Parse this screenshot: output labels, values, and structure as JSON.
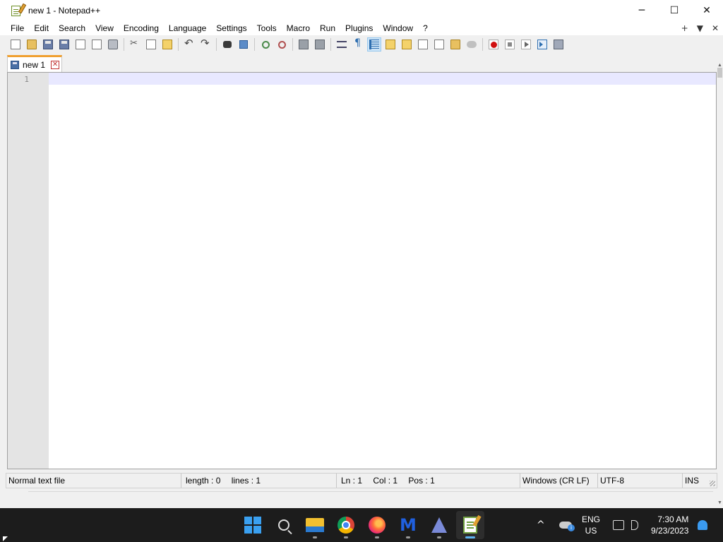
{
  "window": {
    "title": "new 1 - Notepad++",
    "controls": {
      "minimize": "─",
      "maximize": "☐",
      "close": "✕"
    }
  },
  "menu": {
    "items": [
      "File",
      "Edit",
      "Search",
      "View",
      "Encoding",
      "Language",
      "Settings",
      "Tools",
      "Macro",
      "Run",
      "Plugins",
      "Window",
      "?"
    ],
    "right": {
      "add": "+",
      "dropdown": "▼",
      "close": "✕"
    }
  },
  "toolbar": {
    "icons": [
      "new-file-icon",
      "open-file-icon",
      "save-icon",
      "save-all-icon",
      "close-icon",
      "close-all-icon",
      "print-icon",
      "cut-icon",
      "copy-icon",
      "paste-icon",
      "undo-icon",
      "redo-icon",
      "find-icon",
      "replace-icon",
      "zoom-in-icon",
      "zoom-out-icon",
      "sync-vertical-icon",
      "sync-horizontal-icon",
      "word-wrap-icon",
      "show-all-chars-icon",
      "indent-guide-icon",
      "user-lang-icon",
      "doc-map-icon",
      "doc-list-icon",
      "function-list-icon",
      "folder-workspace-icon",
      "monitoring-icon",
      "record-macro-icon",
      "stop-macro-icon",
      "play-macro-icon",
      "run-macro-multiple-icon",
      "save-macro-icon"
    ],
    "active": "indent-guide-icon"
  },
  "tabs": [
    {
      "label": "new 1",
      "close": "✕"
    }
  ],
  "editor": {
    "line_numbers": [
      "1"
    ],
    "content": ""
  },
  "status": {
    "file_type": "Normal text file",
    "length": "length : 0",
    "lines": "lines : 1",
    "ln": "Ln : 1",
    "col": "Col : 1",
    "pos": "Pos : 1",
    "eol": "Windows (CR LF)",
    "encoding": "UTF-8",
    "mode": "INS"
  },
  "taskbar": {
    "apps": [
      "start-icon",
      "search-icon",
      "file-explorer-icon",
      "chrome-icon",
      "firefox-icon",
      "malwarebytes-icon",
      "vm-app-icon",
      "notepadpp-icon"
    ],
    "active_app": "notepadpp-icon",
    "tray": {
      "chevron": "^",
      "lang_line1": "ENG",
      "lang_line2": "US",
      "time": "7:30 AM",
      "date": "9/23/2023"
    }
  },
  "colors": {
    "accent_tab": "#f0a030",
    "current_line": "#e8e8ff",
    "taskbar_bg": "#1c1c1c",
    "active_indicator": "#5cb3f0"
  }
}
